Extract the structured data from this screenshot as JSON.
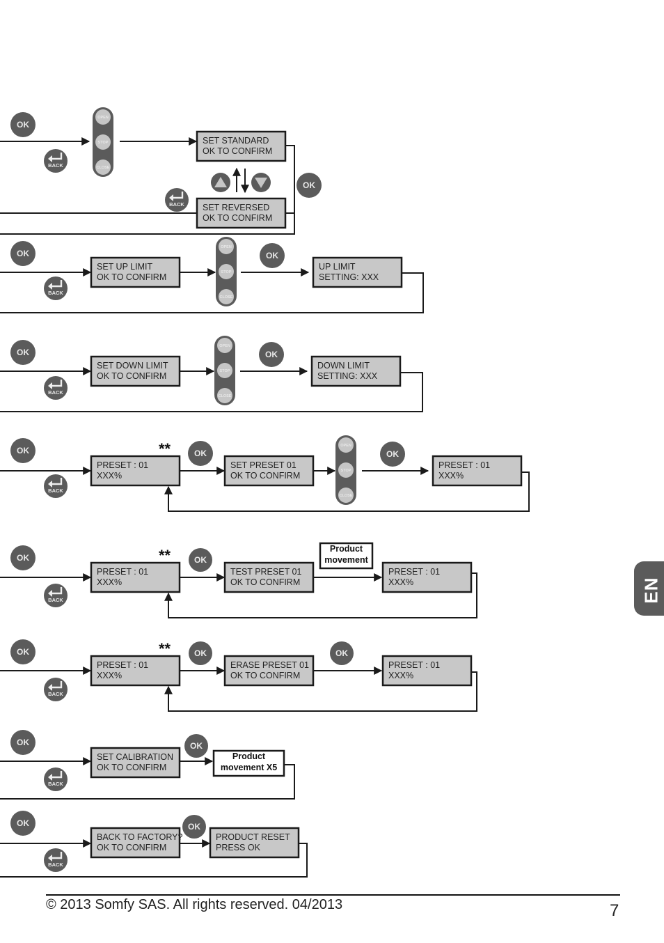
{
  "colors": {
    "screen_fill": "#c8c8c8",
    "button_dark": "#5b5b5b",
    "button_light": "#c6c6c6",
    "line": "#1a1a1a",
    "lang_tab": "#5b5b5b"
  },
  "labels": {
    "ok": "OK",
    "back": "BACK",
    "open": "OPEN",
    "stop": "STOP",
    "close": "CLOSE",
    "stars": "**"
  },
  "rows": [
    {
      "id": "direction",
      "screens": [
        {
          "id": "set-standard",
          "lines": [
            "SET STANDARD",
            "OK TO CONFIRM"
          ]
        },
        {
          "id": "set-reversed",
          "lines": [
            "SET REVERSED",
            "OK TO CONFIRM"
          ]
        }
      ]
    },
    {
      "id": "up-limit",
      "screens": [
        {
          "id": "set-up-limit",
          "lines": [
            "SET UP LIMIT",
            "OK TO CONFIRM"
          ]
        },
        {
          "id": "up-limit-setting",
          "lines": [
            "UP LIMIT",
            "SETTING: XXX"
          ]
        }
      ]
    },
    {
      "id": "down-limit",
      "screens": [
        {
          "id": "set-down-limit",
          "lines": [
            "SET DOWN LIMIT",
            "OK TO CONFIRM"
          ]
        },
        {
          "id": "down-limit-setting",
          "lines": [
            "DOWN LIMIT",
            "SETTING: XXX"
          ]
        }
      ]
    },
    {
      "id": "set-preset",
      "screens": [
        {
          "id": "preset-select",
          "lines": [
            "PRESET : 01",
            "XXX%"
          ]
        },
        {
          "id": "set-preset-confirm",
          "lines": [
            "SET PRESET 01",
            "OK TO CONFIRM"
          ]
        },
        {
          "id": "preset-result",
          "lines": [
            "PRESET : 01",
            "XXX%"
          ]
        }
      ]
    },
    {
      "id": "test-preset",
      "screens": [
        {
          "id": "preset-select",
          "lines": [
            "PRESET : 01",
            "XXX%"
          ]
        },
        {
          "id": "test-preset-confirm",
          "lines": [
            "TEST PRESET 01",
            "OK TO CONFIRM"
          ]
        },
        {
          "id": "preset-result",
          "lines": [
            "PRESET : 01",
            "XXX%"
          ]
        }
      ],
      "note": [
        "Product",
        "movement"
      ]
    },
    {
      "id": "erase-preset",
      "screens": [
        {
          "id": "preset-select",
          "lines": [
            "PRESET : 01",
            "XXX%"
          ]
        },
        {
          "id": "erase-preset-confirm",
          "lines": [
            "ERASE PRESET 01",
            "OK TO CONFIRM"
          ]
        },
        {
          "id": "preset-result",
          "lines": [
            "PRESET : 01",
            "XXX%"
          ]
        }
      ]
    },
    {
      "id": "calibration",
      "screens": [
        {
          "id": "set-calibration",
          "lines": [
            "SET CALIBRATION",
            "OK TO CONFIRM"
          ]
        }
      ],
      "note": [
        "Product",
        "movement X5"
      ]
    },
    {
      "id": "factory-reset",
      "screens": [
        {
          "id": "back-to-factory",
          "lines": [
            "BACK TO FACTORY?",
            "OK TO CONFIRM"
          ]
        },
        {
          "id": "product-reset",
          "lines": [
            "PRODUCT RESET",
            "PRESS OK"
          ]
        }
      ]
    }
  ],
  "footer": {
    "copyright": "© 2013 Somfy SAS. All rights reserved. 04/2013",
    "page_number": "7"
  },
  "language_tab": "EN"
}
